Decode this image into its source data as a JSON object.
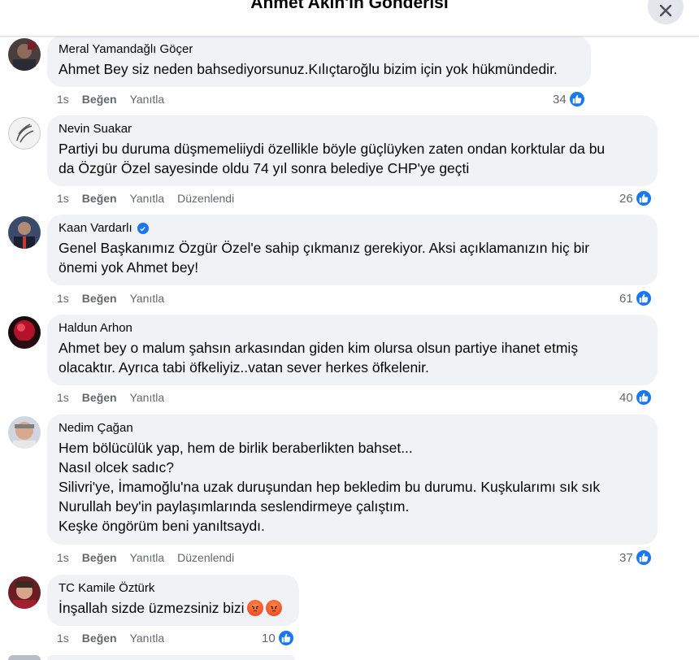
{
  "header": {
    "title": "Ahmet Akın'in Gönderisi"
  },
  "comments": [
    {
      "author": "Meral Yamandağlı Göçer",
      "lines": [
        "Ahmet Bey siz neden bahsediyorsunuz.Kılıçtaroğlu bizim için yok hükmündedir."
      ],
      "time": "1s",
      "like_label": "Beğen",
      "reply_label": "Yanıtla",
      "edited_label": "",
      "reaction_count": "34"
    },
    {
      "author": "Nevin Suakar",
      "lines": [
        "Partiyi bu duruma düşmemeliiydi özellikle böyle güçlüyken zaten ondan korktular da bu",
        "da Özgür Özel sayesinde oldu 74 yıl sonra belediye CHP'ye geçti"
      ],
      "time": "1s",
      "like_label": "Beğen",
      "reply_label": "Yanıtla",
      "edited_label": "Düzenlendi",
      "reaction_count": "26"
    },
    {
      "author": "Kaan Vardarlı",
      "verified": true,
      "lines": [
        "Genel Başkanımız Özgür Özel'e sahip çıkmanız gerekiyor. Aksi açıklamanızın hiç bir",
        "önemi yok Ahmet bey!"
      ],
      "time": "1s",
      "like_label": "Beğen",
      "reply_label": "Yanıtla",
      "edited_label": "",
      "reaction_count": "61"
    },
    {
      "author": "Haldun Arhon",
      "lines": [
        "Ahmet bey o malum şahsın arkasından giden kim olursa olsun partiye ihanet etmiş",
        "olacaktır. Ayrıca tabi öfkeliyiz..vatan sever herkes öfkelenir."
      ],
      "time": "1s",
      "like_label": "Beğen",
      "reply_label": "Yanıtla",
      "edited_label": "",
      "reaction_count": "40"
    },
    {
      "author": "Nedim Çağan",
      "lines": [
        "Hem bölücülük yap, hem de birlik beraberlikten bahset...",
        "Nasıl olcek sadıc?",
        "Silivri'ye, İmamoğlu'na uzak duruşundan hep bekledim bu durumu. Kuşkularımı sık sık",
        "Nurullah bey'in paylaşımlarında seslendirmeye çalıştım.",
        "Keşke öngörüm beni yanıltsaydı."
      ],
      "time": "1s",
      "like_label": "Beğen",
      "reply_label": "Yanıtla",
      "edited_label": "Düzenlendi",
      "reaction_count": "37"
    },
    {
      "author": "TC Kamile Öztürk",
      "lines": [
        "İnşallah sizde üzmezsiniz bizi"
      ],
      "time": "1s",
      "like_label": "Beğen",
      "reply_label": "Yanıtla",
      "edited_label": "",
      "reaction_count": "10"
    }
  ],
  "colors": {
    "accent": "#1877f2",
    "bubble": "#f0f2f5",
    "muted": "#65676b"
  },
  "icons": {
    "close": "close-icon",
    "like": "like-reaction-icon",
    "angry": "angry-reaction-icon",
    "verified": "verified-badge-icon"
  }
}
